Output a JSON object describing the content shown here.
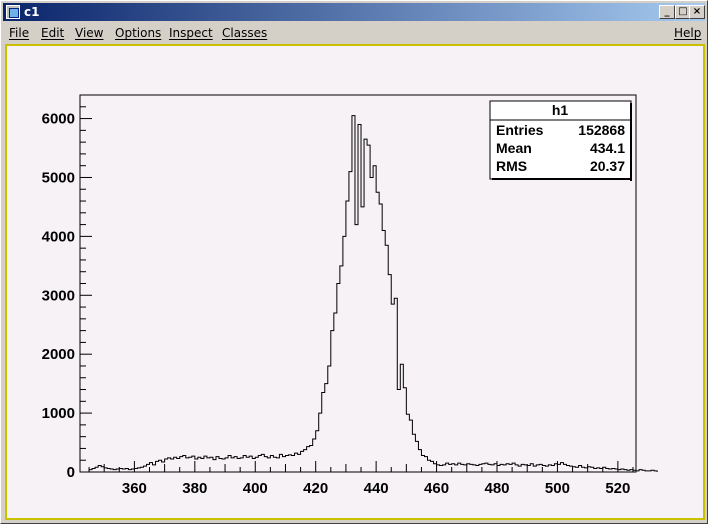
{
  "window": {
    "title": "c1",
    "controls": {
      "minimize": "_",
      "maximize": "□",
      "close": "×"
    }
  },
  "menu": {
    "items": [
      "File",
      "Edit",
      "View",
      "Options",
      "Inspect",
      "Classes"
    ],
    "help": "Help"
  },
  "stats": {
    "title": "h1",
    "rows": [
      {
        "label": "Entries",
        "value": "152868"
      },
      {
        "label": "Mean",
        "value": "434.1"
      },
      {
        "label": "RMS",
        "value": "20.37"
      }
    ]
  },
  "chart_data": {
    "type": "bar",
    "style": "step-histogram",
    "title": "",
    "xlabel": "",
    "ylabel": "",
    "xlim": [
      342,
      526
    ],
    "ylim": [
      0,
      6400
    ],
    "xticks": [
      360,
      380,
      400,
      420,
      440,
      460,
      480,
      500,
      520
    ],
    "yticks": [
      0,
      1000,
      2000,
      3000,
      4000,
      5000,
      6000
    ],
    "bin_width": 1,
    "x_start": 345,
    "values": [
      40,
      60,
      80,
      110,
      90,
      70,
      60,
      50,
      40,
      50,
      60,
      50,
      60,
      40,
      50,
      60,
      70,
      80,
      100,
      130,
      160,
      120,
      180,
      200,
      170,
      220,
      240,
      220,
      250,
      230,
      260,
      280,
      240,
      250,
      270,
      220,
      250,
      230,
      270,
      240,
      250,
      210,
      260,
      230,
      220,
      240,
      280,
      240,
      260,
      230,
      240,
      280,
      250,
      270,
      230,
      250,
      280,
      300,
      260,
      240,
      280,
      250,
      240,
      300,
      260,
      280,
      290,
      280,
      320,
      300,
      350,
      380,
      430,
      450,
      560,
      700,
      1000,
      1350,
      1500,
      1800,
      2400,
      2700,
      3200,
      3500,
      4000,
      4600,
      5100,
      6050,
      4200,
      5900,
      4500,
      5650,
      5550,
      5000,
      5200,
      4750,
      4550,
      4100,
      3850,
      3350,
      2850,
      2950,
      1400,
      1830,
      1430,
      980,
      880,
      640,
      520,
      380,
      280,
      260,
      200,
      180,
      140,
      120,
      110,
      120,
      150,
      130,
      140,
      120,
      150,
      130,
      120,
      140,
      130,
      120,
      110,
      130,
      140,
      150,
      130,
      120,
      140,
      110,
      130,
      120,
      140,
      130,
      150,
      120,
      100,
      130,
      120,
      110,
      140,
      100,
      120,
      130,
      110,
      100,
      120,
      110,
      140,
      130,
      160,
      130,
      110,
      100,
      90,
      80,
      110,
      80,
      70,
      90,
      80,
      60,
      70,
      60,
      80,
      60,
      50,
      60,
      50,
      40,
      50,
      40,
      30,
      40,
      30,
      20,
      40,
      30,
      20,
      20,
      30,
      20
    ]
  }
}
